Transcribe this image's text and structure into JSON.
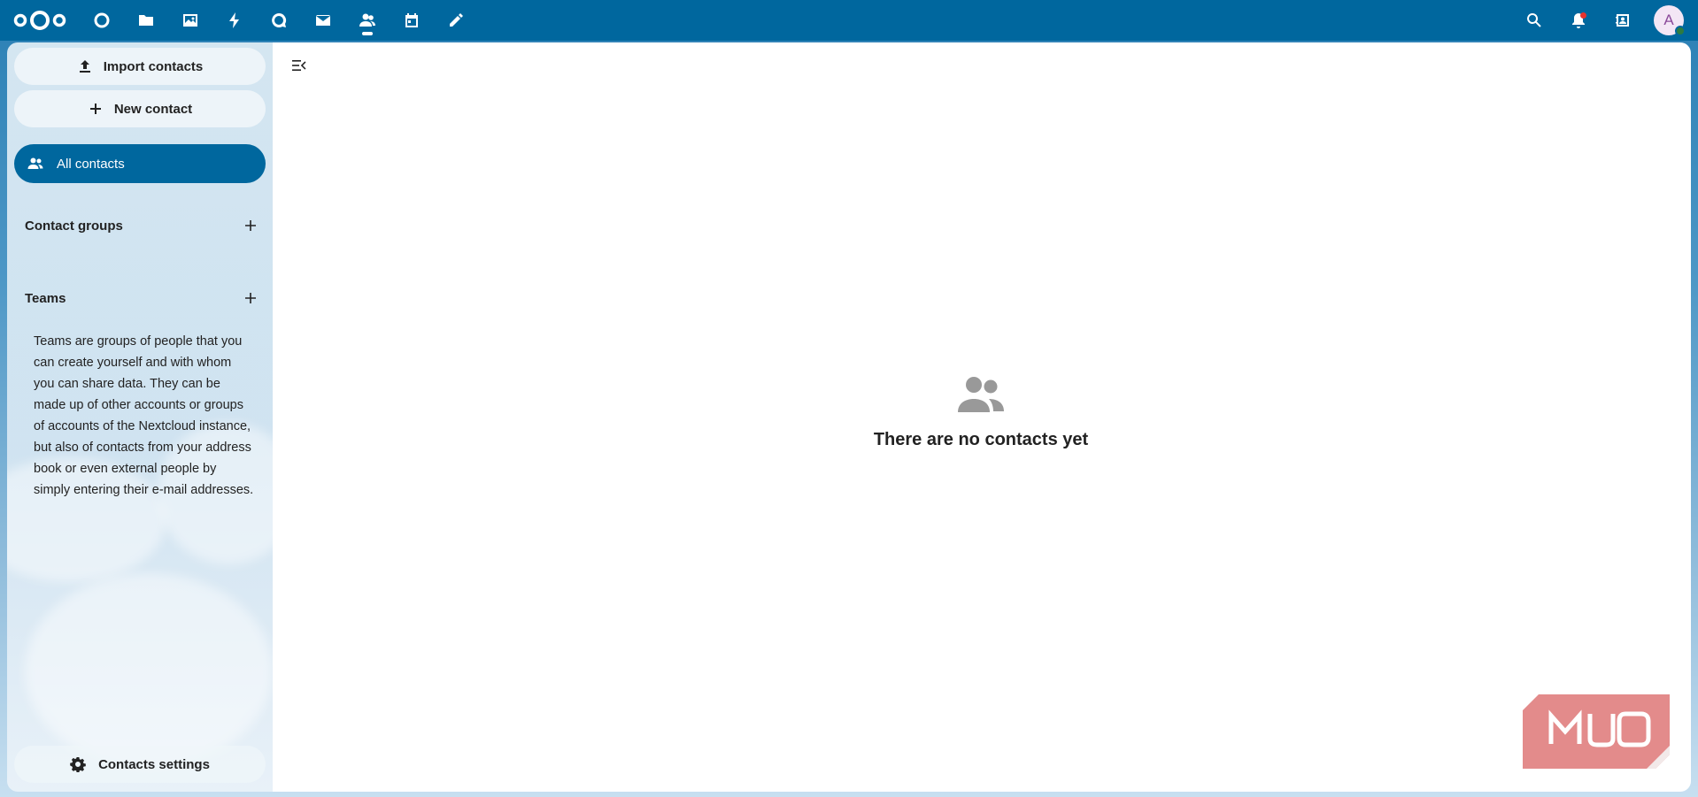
{
  "topbar": {
    "logo_icon": "nextcloud-logo",
    "apps": [
      {
        "name": "dashboard",
        "icon": "dashboard-icon"
      },
      {
        "name": "files",
        "icon": "folder-icon"
      },
      {
        "name": "photos",
        "icon": "image-icon"
      },
      {
        "name": "activity",
        "icon": "bolt-icon"
      },
      {
        "name": "talk",
        "icon": "talk-icon"
      },
      {
        "name": "mail",
        "icon": "mail-icon"
      },
      {
        "name": "contacts",
        "icon": "contacts-icon",
        "active": true
      },
      {
        "name": "calendar",
        "icon": "calendar-icon"
      },
      {
        "name": "notes",
        "icon": "pencil-icon"
      }
    ],
    "right_icons": [
      "search-icon",
      "bell-icon",
      "contacts-menu-icon"
    ],
    "avatar_letter": "A",
    "accent_color": "#00679e"
  },
  "sidebar": {
    "import_label": "Import contacts",
    "new_contact_label": "New contact",
    "all_contacts_label": "All contacts",
    "contact_groups_label": "Contact groups",
    "teams_label": "Teams",
    "teams_description": "Teams are groups of people that you can create yourself and with whom you can share data. They can be made up of other accounts or groups of accounts of the Nextcloud instance, but also of contacts from your address book or even external people by simply entering their e-mail addresses.",
    "settings_label": "Contacts settings"
  },
  "main": {
    "empty_title": "There are no contacts yet",
    "empty_icon": "group-icon"
  },
  "watermark": {
    "text": "MUO",
    "color": "#e28585"
  }
}
